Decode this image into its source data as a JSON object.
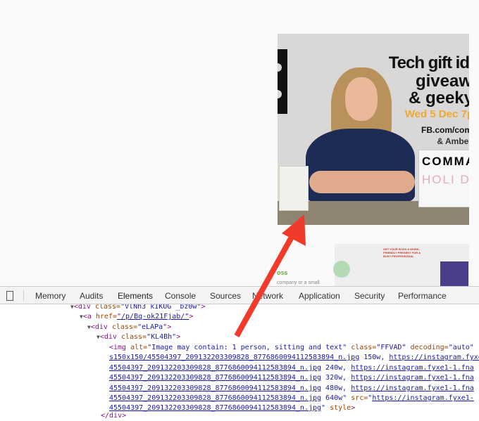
{
  "photo": {
    "lines": [
      "Tech gift id",
      "giveaw",
      "& geeky",
      "Wed 5 Dec 7p",
      "FB.com/com",
      "& Amber"
    ],
    "lightbox": [
      "COMMA",
      "HOLI DA"
    ]
  },
  "photo2": {
    "heading": "GET YOUR BOSS A WORK-FRIENDLY PRESENT FOR A BUSY PROFESSIONAL",
    "left_heading": "oss",
    "left_text": "company or a small"
  },
  "devtools": {
    "tabs": [
      "Memory",
      "Audits",
      "Elements",
      "Console",
      "Sources",
      "Network",
      "Application",
      "Security",
      "Performance"
    ],
    "active_tab": "Elements"
  },
  "code": {
    "l1": {
      "tag": "<div ",
      "attr": "class=",
      "val": "\"VlNh3 kIKUG  _bz0w\"",
      "end": ">"
    },
    "l2": {
      "tag": "<a ",
      "attr": "href=",
      "val": "\"/p/Bq-ok21Fjab/\"",
      "end": ">"
    },
    "l3": {
      "tag": "<div ",
      "attr": "class=",
      "val": "\"eLAPa\"",
      "end": ">"
    },
    "l4": {
      "tag": "<div ",
      "attr": "class=",
      "val": "\"KL4Bh\"",
      "end": ">"
    },
    "l5": {
      "tag": "<img ",
      "a1": "alt=",
      "v1": "\"Image may contain: 1 person, sitting and text\"",
      "a2": " class=",
      "v2": "\"FFVAD\"",
      "a3": " decoding=",
      "v3": "\"auto\""
    },
    "l6": {
      "link": "s150x150/45504397_209132203309828_8776860094112583894_n.jpg",
      "size": " 150w, ",
      "link2": "https://instagram.fyxe1-1.fna"
    },
    "l7": {
      "link": "45504397_209132203309828_8776860094112583894_n.jpg",
      "size": " 240w, ",
      "link2": "https://instagram.fyxe1-1.fna"
    },
    "l8": {
      "link": "45504397_209132203309828_8776860094112583894_n.jpg",
      "size": " 320w, ",
      "link2": "https://instagram.fyxe1-1.fna"
    },
    "l9": {
      "link": "45504397_209132203309828_8776860094112583894_n.jpg",
      "size": " 480w, ",
      "link2": "https://instagram.fyxe1-1.fna"
    },
    "l10": {
      "link": "45504397_209132203309828_8776860094112583894_n.jpg",
      "size": " 640w\" ",
      "attr": "src=",
      "q": "\"",
      "link2": "https://instagram.fyxe1-"
    },
    "l11": {
      "link": "45504397_209132203309828_8776860094112583894_n.jpg",
      "end": "\" ",
      "attr": "style",
      "close": ">"
    },
    "l12": {
      "tag": "</div>"
    }
  },
  "colors": {
    "arrow": "#f03a2a",
    "link": "#1a1aa6",
    "tag": "#881280",
    "attr": "#994500"
  }
}
